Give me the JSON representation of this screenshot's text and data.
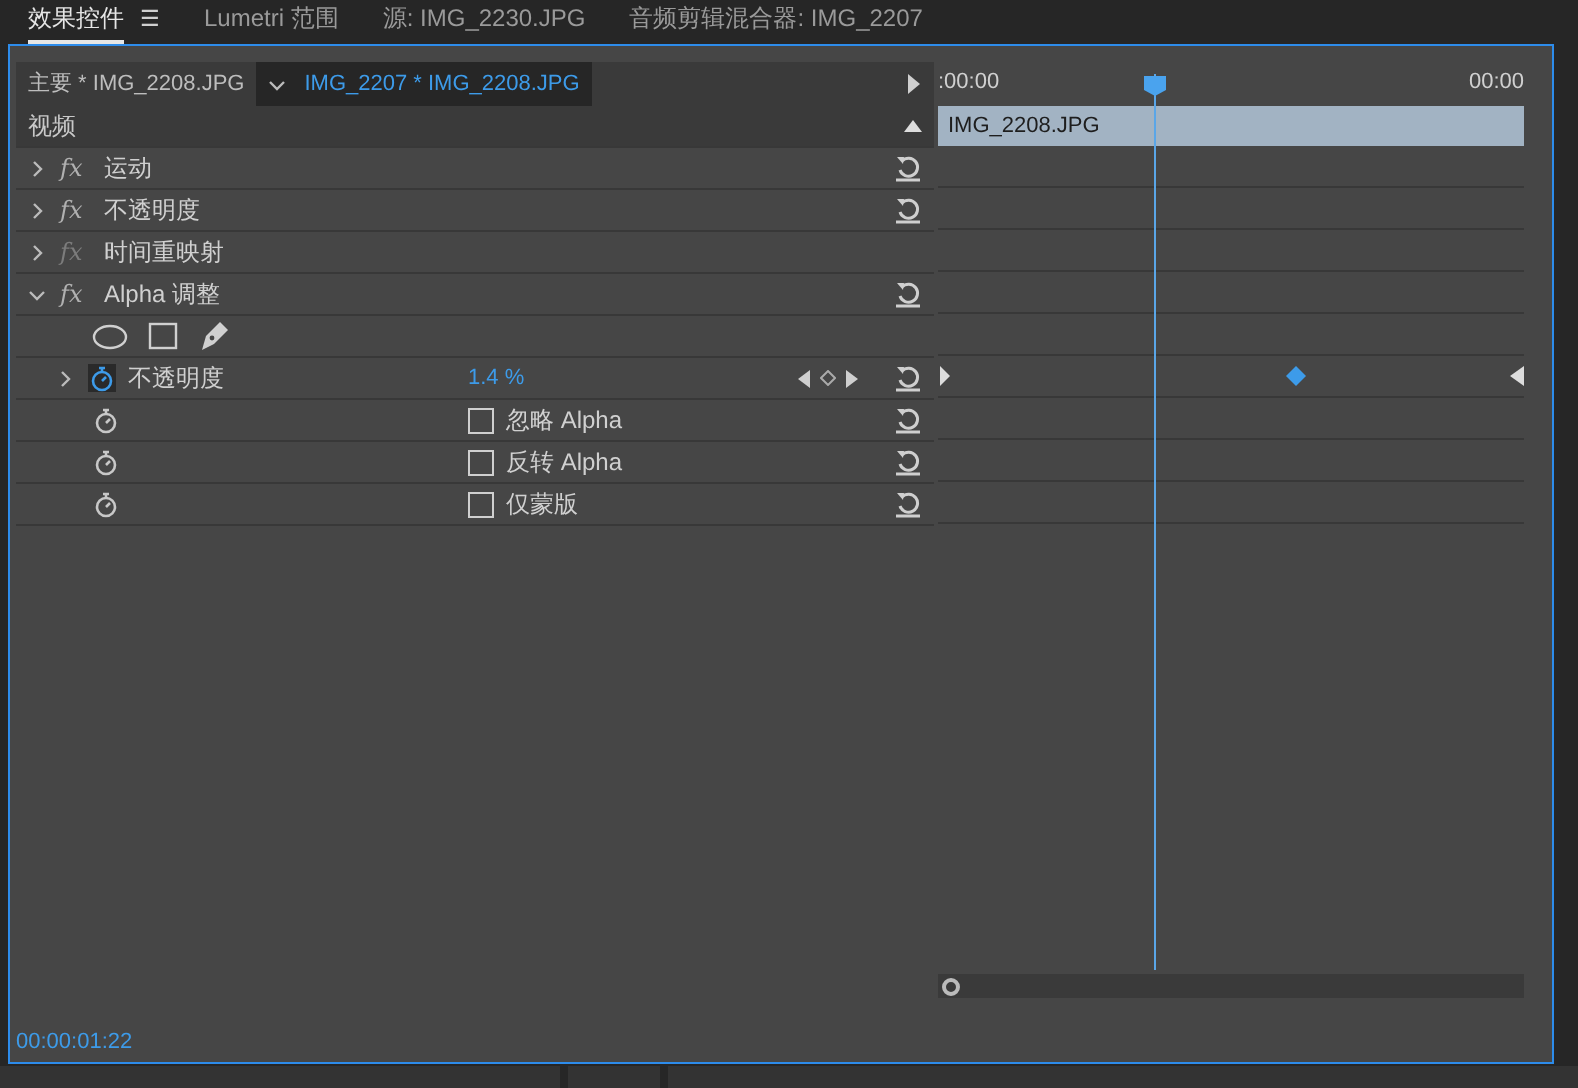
{
  "panel_tabs": [
    {
      "label": "效果控件",
      "selected": true,
      "menu": "☰"
    },
    {
      "label": "Lumetri 范围",
      "selected": false
    },
    {
      "label": "源: IMG_2230.JPG",
      "selected": false
    },
    {
      "label": "音频剪辑混合器: IMG_2207",
      "selected": false
    }
  ],
  "clip_tabs": [
    {
      "label": "主要 * IMG_2208.JPG",
      "selected": false
    },
    {
      "label": "IMG_2207 * IMG_2208.JPG",
      "selected": true
    }
  ],
  "section": "视频",
  "effects": [
    {
      "fx": "fx",
      "label": "运动",
      "expanded": false,
      "enabled": true,
      "resettable": true
    },
    {
      "fx": "fx",
      "label": "不透明度",
      "expanded": false,
      "enabled": true,
      "resettable": true
    },
    {
      "fx": "fx",
      "label": "时间重映射",
      "expanded": false,
      "enabled": false,
      "resettable": false
    },
    {
      "fx": "fx",
      "label": "Alpha 调整",
      "expanded": true,
      "enabled": true,
      "resettable": true,
      "children": [
        {
          "kind": "masks"
        },
        {
          "kind": "param",
          "label": "不透明度",
          "value": "1.4 %",
          "animated": true
        },
        {
          "kind": "checkbox",
          "label": "忽略 Alpha",
          "checked": false
        },
        {
          "kind": "checkbox",
          "label": "反转 Alpha",
          "checked": false
        },
        {
          "kind": "checkbox",
          "label": "仅蒙版",
          "checked": false
        }
      ]
    }
  ],
  "timeline": {
    "ruler_start": ":00:00",
    "ruler_end": "00:00",
    "clip": "IMG_2208.JPG"
  },
  "timecode": "00:00:01:22"
}
